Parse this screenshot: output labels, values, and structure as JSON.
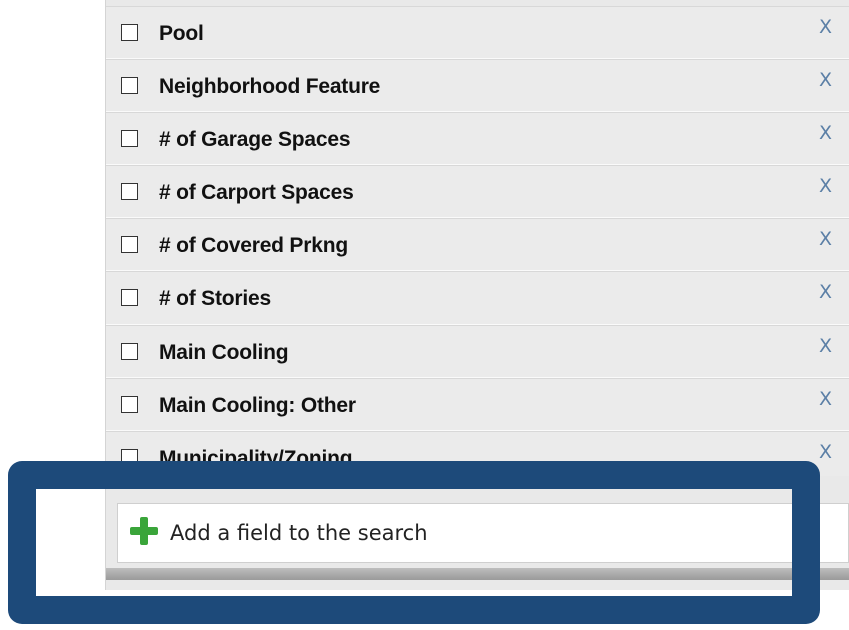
{
  "fields": [
    {
      "label": "Pool",
      "remove": "X"
    },
    {
      "label": "Neighborhood Feature",
      "remove": "X"
    },
    {
      "label": "# of Garage Spaces",
      "remove": "X"
    },
    {
      "label": "# of Carport Spaces",
      "remove": "X"
    },
    {
      "label": "# of Covered Prkng",
      "remove": "X"
    },
    {
      "label": "# of Stories",
      "remove": "X"
    },
    {
      "label": "Main Cooling",
      "remove": "X"
    },
    {
      "label": "Main Cooling: Other",
      "remove": "X"
    },
    {
      "label": "Municipality/Zoning",
      "remove": "X"
    }
  ],
  "add_field": {
    "label": "Add a field to the search",
    "icon": "plus-icon"
  },
  "colors": {
    "highlight": "#1d4a7a",
    "remove_x": "#5b7fa6",
    "plus": "#3aa53a",
    "row_bg": "#ebebeb"
  }
}
